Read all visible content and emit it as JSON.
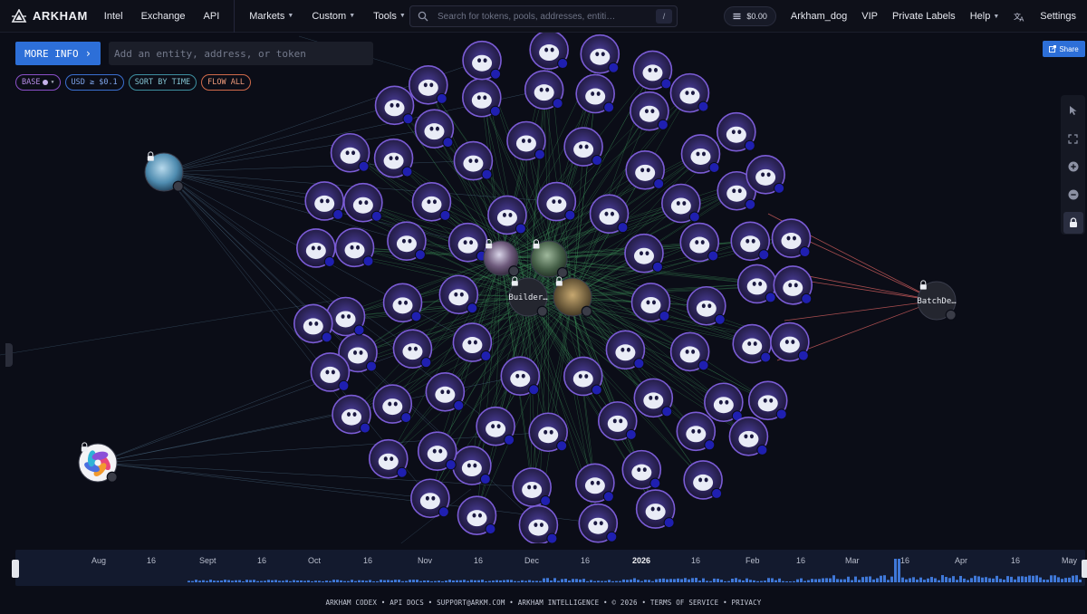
{
  "brand": {
    "name": "ARKHAM"
  },
  "nav": {
    "intel": "Intel",
    "exchange": "Exchange",
    "api": "API",
    "markets": "Markets",
    "custom": "Custom",
    "tools": "Tools"
  },
  "search": {
    "placeholder": "Search for tokens, pools, addresses, entiti…",
    "shortcut": "/"
  },
  "account": {
    "balance": "$0.00",
    "username": "Arkham_dog",
    "vip": "VIP",
    "private_labels": "Private Labels",
    "help": "Help",
    "settings": "Settings"
  },
  "toolbar": {
    "more_info": "MORE INFO",
    "entity_placeholder": "Add an entity, address, or token",
    "share": "Share"
  },
  "filters": {
    "base": "BASE",
    "usd": "USD ≥ $0.1",
    "sort": "SORT BY TIME",
    "flow": "FLOW ALL"
  },
  "graph": {
    "center_node_label": "Builder…",
    "right_node_label": "BatchDe…",
    "colors": {
      "wallet_fill": "#2b2356",
      "wallet_ring": "#7b5cd6",
      "hub_edge": "#3f9a5c",
      "outflow_edge": "#c85a5a",
      "side_edge": "#4e6f88",
      "badge": "#1f1fb0"
    }
  },
  "timeline": {
    "months": [
      "Aug",
      "16",
      "Sept",
      "16",
      "Oct",
      "16",
      "Nov",
      "16",
      "Dec",
      "16",
      "2026",
      "16",
      "Feb",
      "16",
      "Mar",
      "16",
      "Apr",
      "16",
      "May"
    ]
  },
  "footer": {
    "codex": "ARKHAM CODEX",
    "api_docs": "API DOCS",
    "support": "SUPPORT@ARKM.COM",
    "intelligence": "ARKHAM INTELLIGENCE",
    "copyright": "© 2026",
    "terms": "TERMS OF SERVICE",
    "privacy": "PRIVACY",
    "separator": "•"
  }
}
